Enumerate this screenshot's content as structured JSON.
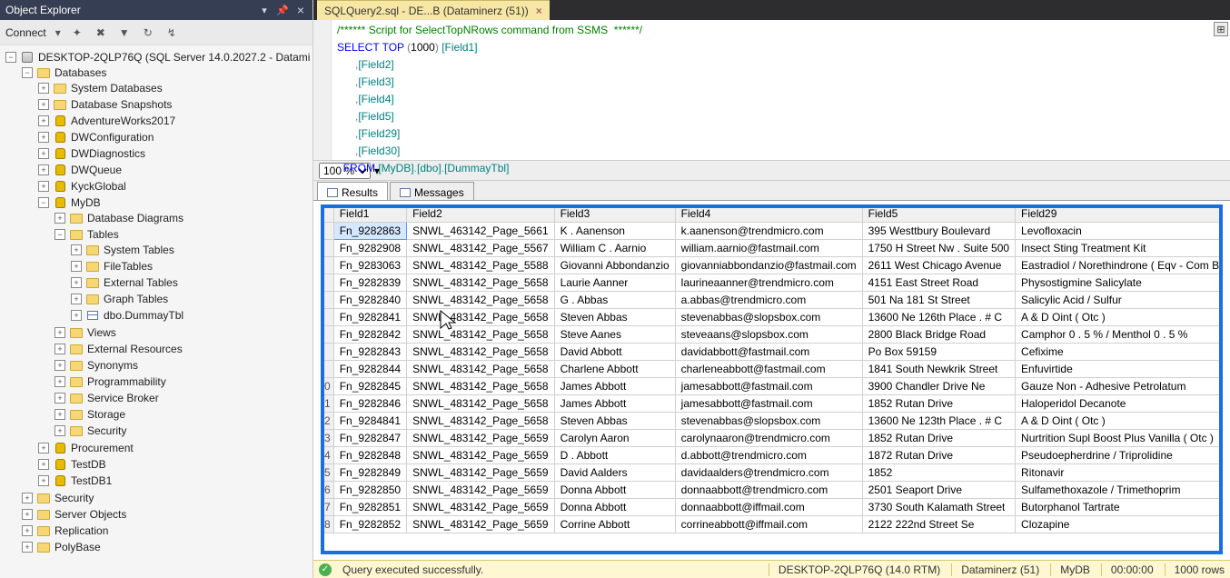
{
  "panel": {
    "title": "Object Explorer",
    "connect": "Connect"
  },
  "tree": {
    "server": "DESKTOP-2QLP76Q (SQL Server 14.0.2027.2 - Datami",
    "databases": "Databases",
    "sysdb": "System Databases",
    "snap": "Database Snapshots",
    "adv": "AdventureWorks2017",
    "dwc": "DWConfiguration",
    "dwd": "DWDiagnostics",
    "dwq": "DWQueue",
    "kyck": "KyckGlobal",
    "mydb": "MyDB",
    "diag": "Database Diagrams",
    "tables": "Tables",
    "syst": "System Tables",
    "filet": "FileTables",
    "extt": "External Tables",
    "grapht": "Graph Tables",
    "dummy": "dbo.DummayTbl",
    "views": "Views",
    "extres": "External Resources",
    "syn": "Synonyms",
    "prog": "Programmability",
    "sb": "Service Broker",
    "stor": "Storage",
    "sec": "Security",
    "proc": "Procurement",
    "testdb": "TestDB",
    "testdb1": "TestDB1",
    "sec2": "Security",
    "so": "Server Objects",
    "repl": "Replication",
    "poly": "PolyBase"
  },
  "tab": {
    "label": "SQLQuery2.sql - DE...B (Dataminerz (51))"
  },
  "sql": {
    "l1a": "/****** Script for SelectTopNRows command from SSMS  ******/",
    "l2a": "SELECT",
    "l2b": " TOP ",
    "l2c": "(",
    "l2d": "1000",
    "l2e": ") ",
    "l2f": "[Field1]",
    "l3": "      ,",
    "l3f": "[Field2]",
    "l4": "      ,",
    "l4f": "[Field3]",
    "l5": "      ,",
    "l5f": "[Field4]",
    "l6": "      ,",
    "l6f": "[Field5]",
    "l7": "      ,",
    "l7f": "[Field29]",
    "l8": "      ,",
    "l8f": "[Field30]",
    "l9a": "  FROM ",
    "l9b": "[MyDB]",
    "l9c": ".",
    "l9d": "[dbo]",
    "l9e": ".",
    "l9f": "[DummayTbl]"
  },
  "zoom": "100 %",
  "rtab": {
    "results": "Results",
    "messages": "Messages"
  },
  "cols": {
    "c1": "Field1",
    "c2": "Field2",
    "c3": "Field3",
    "c4": "Field4",
    "c5": "Field5",
    "c6": "Field29"
  },
  "rows": [
    {
      "n": "",
      "f1": "Fn_9282863",
      "f2": "SNWL_463142_Page_5661",
      "f3": "K . Aanenson",
      "f4": "k.aanenson@trendmicro.com",
      "f5": "395 Westtbury Boulevard",
      "f6": "Levofloxacin"
    },
    {
      "n": "",
      "f1": "Fn_9282908",
      "f2": "SNWL_483142_Page_5567",
      "f3": "William C . Aarnio",
      "f4": "william.aarnio@fastmail.com",
      "f5": "1750 H Street Nw . Suite 500",
      "f6": "Insect Sting Treatment Kit"
    },
    {
      "n": "",
      "f1": "Fn_9283063",
      "f2": "SNWL_483142_Page_5588",
      "f3": "Giovanni Abbondanzio",
      "f4": "giovanniabbondanzio@fastmail.com",
      "f5": "2611 West Chicago Avenue",
      "f6": "Eastradiol / Norethindrone ( Eqv - Com Bipatch"
    },
    {
      "n": "",
      "f1": "Fn_9282839",
      "f2": "SNWL_483142_Page_5658",
      "f3": "Laurie Aanner",
      "f4": "laurineaanner@trendmicro.com",
      "f5": "4151 East Street Road",
      "f6": "Physostigmine Salicylate"
    },
    {
      "n": "",
      "f1": "Fn_9282840",
      "f2": "SNWL_483142_Page_5658",
      "f3": "G . Abbas",
      "f4": "a.abbas@trendmicro.com",
      "f5": "501 Na 181 St Street",
      "f6": "Salicylic Acid / Sulfur"
    },
    {
      "n": "",
      "f1": "Fn_9282841",
      "f2": "SNWL_483142_Page_5658",
      "f3": "Steven Abbas",
      "f4": "stevenabbas@slopsbox.com",
      "f5": "13600 Ne 126th  Place . # C",
      "f6": "A & D Oint ( Otc )"
    },
    {
      "n": "",
      "f1": "Fn_9282842",
      "f2": "SNWL_483142_Page_5658",
      "f3": "Steve Aanes",
      "f4": "steveaans@slopsbox.com",
      "f5": "2800 Black Bridge Road",
      "f6": "Camphor 0 . 5 % / Menthol 0 . 5 %"
    },
    {
      "n": "",
      "f1": "Fn_9282843",
      "f2": "SNWL_483142_Page_5658",
      "f3": "David Abbott",
      "f4": "davidabbott@fastmail.com",
      "f5": "Po Box 59159",
      "f6": "Cefixime"
    },
    {
      "n": "",
      "f1": "Fn_9282844",
      "f2": "SNWL_483142_Page_5658",
      "f3": "Charlene Abbott",
      "f4": "charleneabbott@fastmail.com",
      "f5": "1841 South Newkrik Street",
      "f6": "Enfuvirtide"
    },
    {
      "n": "0",
      "f1": "Fn_9282845",
      "f2": "SNWL_483142_Page_5658",
      "f3": "James Abbott",
      "f4": "jamesabbott@fastmail.com",
      "f5": "3900 Chandler Drive Ne",
      "f6": "Gauze Non - Adhesive Petrolatum"
    },
    {
      "n": "1",
      "f1": "Fn_9282846",
      "f2": "SNWL_483142_Page_5658",
      "f3": "James Abbott",
      "f4": "jamesabbott@fastmail.com",
      "f5": "1852 Rutan Drive",
      "f6": "Haloperidol Decanote"
    },
    {
      "n": "2",
      "f1": "Fn_9284841",
      "f2": "SNWL_483142_Page_5658",
      "f3": "Steven Abbas",
      "f4": "stevenabbas@slopsbox.com",
      "f5": "13600 Ne 123th Place . # C",
      "f6": "A & D Oint ( Otc )"
    },
    {
      "n": "3",
      "f1": "Fn_9282847",
      "f2": "SNWL_483142_Page_5659",
      "f3": "Carolyn Aaron",
      "f4": "carolynaaron@trendmicro.com",
      "f5": "1852 Rutan Drive",
      "f6": "Nurtrition Supl Boost Plus Vanilla ( Otc )"
    },
    {
      "n": "4",
      "f1": "Fn_9282848",
      "f2": "SNWL_483142_Page_5659",
      "f3": "D . Abbott",
      "f4": "d.abbott@trendmicro.com",
      "f5": "1872 Rutan Drive",
      "f6": "Pseudoepherdrine / Triprolidine"
    },
    {
      "n": "5",
      "f1": "Fn_9282849",
      "f2": "SNWL_483142_Page_5659",
      "f3": "David Aalders",
      "f4": "davidaalders@trendmicro.com",
      "f5": "1852",
      "f6": "Ritonavir"
    },
    {
      "n": "6",
      "f1": "Fn_9282850",
      "f2": "SNWL_483142_Page_5659",
      "f3": "Donna Abbott",
      "f4": "donnaabbott@trendmicro.com",
      "f5": "2501 Seaport Drive",
      "f6": "Sulfamethoxazole / Trimethoprim"
    },
    {
      "n": "7",
      "f1": "Fn_9282851",
      "f2": "SNWL_483142_Page_5659",
      "f3": "Donna Abbott",
      "f4": "donnaabbott@iffmail.com",
      "f5": "3730 South Kalamath Street",
      "f6": "Butorphanol Tartrate"
    },
    {
      "n": "8",
      "f1": "Fn_9282852",
      "f2": "SNWL_483142_Page_5659",
      "f3": "Corrine Abbott",
      "f4": "corrineabbott@iffmail.com",
      "f5": "2122 222nd Street Se",
      "f6": "Clozapine"
    }
  ],
  "status": {
    "msg": "Query executed successfully.",
    "server": "DESKTOP-2QLP76Q (14.0 RTM)",
    "user": "Dataminerz (51)",
    "db": "MyDB",
    "time": "00:00:00",
    "rows": "1000 rows"
  }
}
